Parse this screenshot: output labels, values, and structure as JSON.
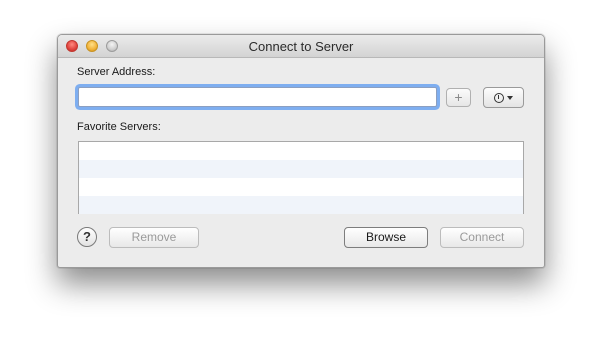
{
  "window": {
    "title": "Connect to Server"
  },
  "server_address": {
    "label": "Server Address:",
    "value": "",
    "placeholder": ""
  },
  "controls": {
    "add_label": "+",
    "recent_icon": "clock-icon"
  },
  "favorites": {
    "label": "Favorite Servers:",
    "items": []
  },
  "buttons": {
    "help": "?",
    "remove": "Remove",
    "browse": "Browse",
    "connect": "Connect"
  }
}
